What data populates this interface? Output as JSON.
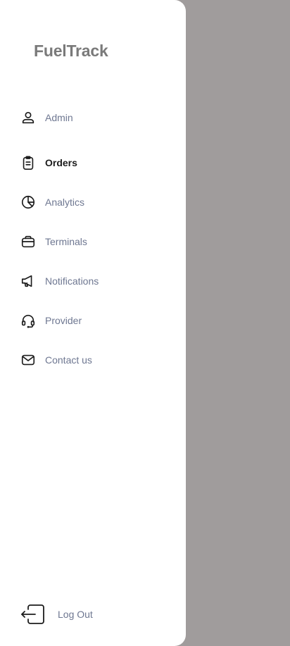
{
  "app": {
    "title": "FuelTrack"
  },
  "nav": {
    "items": [
      {
        "label": "Admin",
        "icon": "user-icon",
        "active": false
      },
      {
        "label": "Orders",
        "icon": "clipboard-icon",
        "active": true
      },
      {
        "label": "Analytics",
        "icon": "pie-chart-icon",
        "active": false
      },
      {
        "label": "Terminals",
        "icon": "briefcase-icon",
        "active": false
      },
      {
        "label": "Notifications",
        "icon": "megaphone-icon",
        "active": false
      },
      {
        "label": "Provider",
        "icon": "headset-icon",
        "active": false
      },
      {
        "label": "Contact us",
        "icon": "mail-icon",
        "active": false
      }
    ]
  },
  "footer": {
    "logout_label": "Log Out",
    "logout_icon": "logout-icon"
  },
  "colors": {
    "overlay": "#a09c9c",
    "drawer": "#ffffff",
    "label": "#6e7791",
    "active_label": "#1c1c1c",
    "brand": "#7a7a7a"
  }
}
